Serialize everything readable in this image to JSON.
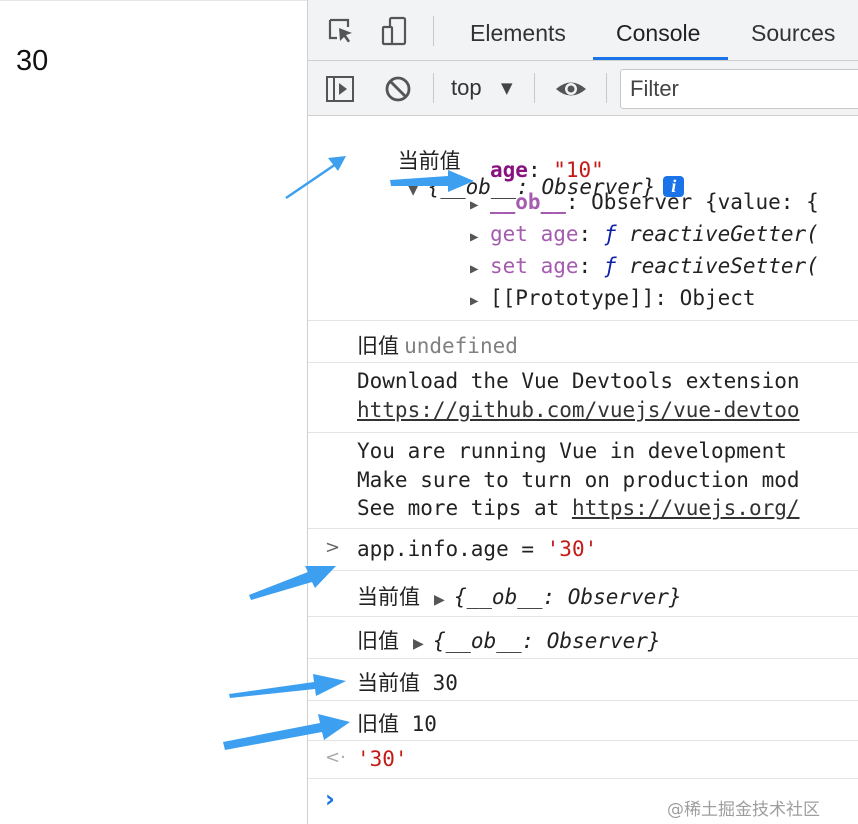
{
  "page": {
    "value": "30"
  },
  "devtools": {
    "tabs": [
      {
        "label": "Elements"
      },
      {
        "label": "Console"
      },
      {
        "label": "Sources"
      }
    ],
    "toolbar": {
      "context": "top",
      "context_arrow": "▼",
      "filter_placeholder": "Filter"
    }
  },
  "console": {
    "entry1": {
      "label": "当前值",
      "summary": "{__ob__: Observer}",
      "info": "i",
      "props": [
        {
          "key": "age",
          "sep": ": ",
          "value": "\"10\""
        },
        {
          "key": "__ob__",
          "sep": ": ",
          "value": "Observer {value: {"
        },
        {
          "key": "get age",
          "sep": ": ",
          "f": "ƒ",
          "value": "reactiveGetter("
        },
        {
          "key": "set age",
          "sep": ": ",
          "f": "ƒ",
          "value": "reactiveSetter("
        },
        {
          "key": "[[Prototype]]",
          "sep": ": ",
          "value": "Object"
        }
      ]
    },
    "entry2": {
      "label": "旧值",
      "value": "undefined"
    },
    "entry3": {
      "line1": "Download the Vue Devtools extension",
      "link": "https://github.com/vuejs/vue-devtoo"
    },
    "entry4": {
      "line1": "You are running Vue in development",
      "line2": "Make sure to turn on production mod",
      "line3_prefix": "See more tips at ",
      "line3_link": "https://vuejs.org/"
    },
    "entry5": {
      "code_obj": "app.info.age",
      "code_op": " = ",
      "code_val": "'30'"
    },
    "entry6": {
      "label": "当前值",
      "summary": "{__ob__: Observer}"
    },
    "entry7": {
      "label": "旧值",
      "summary": "{__ob__: Observer}"
    },
    "entry8": {
      "text": "当前值 30"
    },
    "entry9": {
      "text": "旧值 10"
    },
    "entry10": {
      "value": "'30'"
    },
    "prompt": {
      "symbol": "›"
    }
  },
  "watermark": "@稀土掘金技术社区",
  "colors": {
    "arrow": "#3d9ff0",
    "tab_underline": "#1a73e8",
    "property_key": "#881280",
    "string": "#c41a16"
  }
}
